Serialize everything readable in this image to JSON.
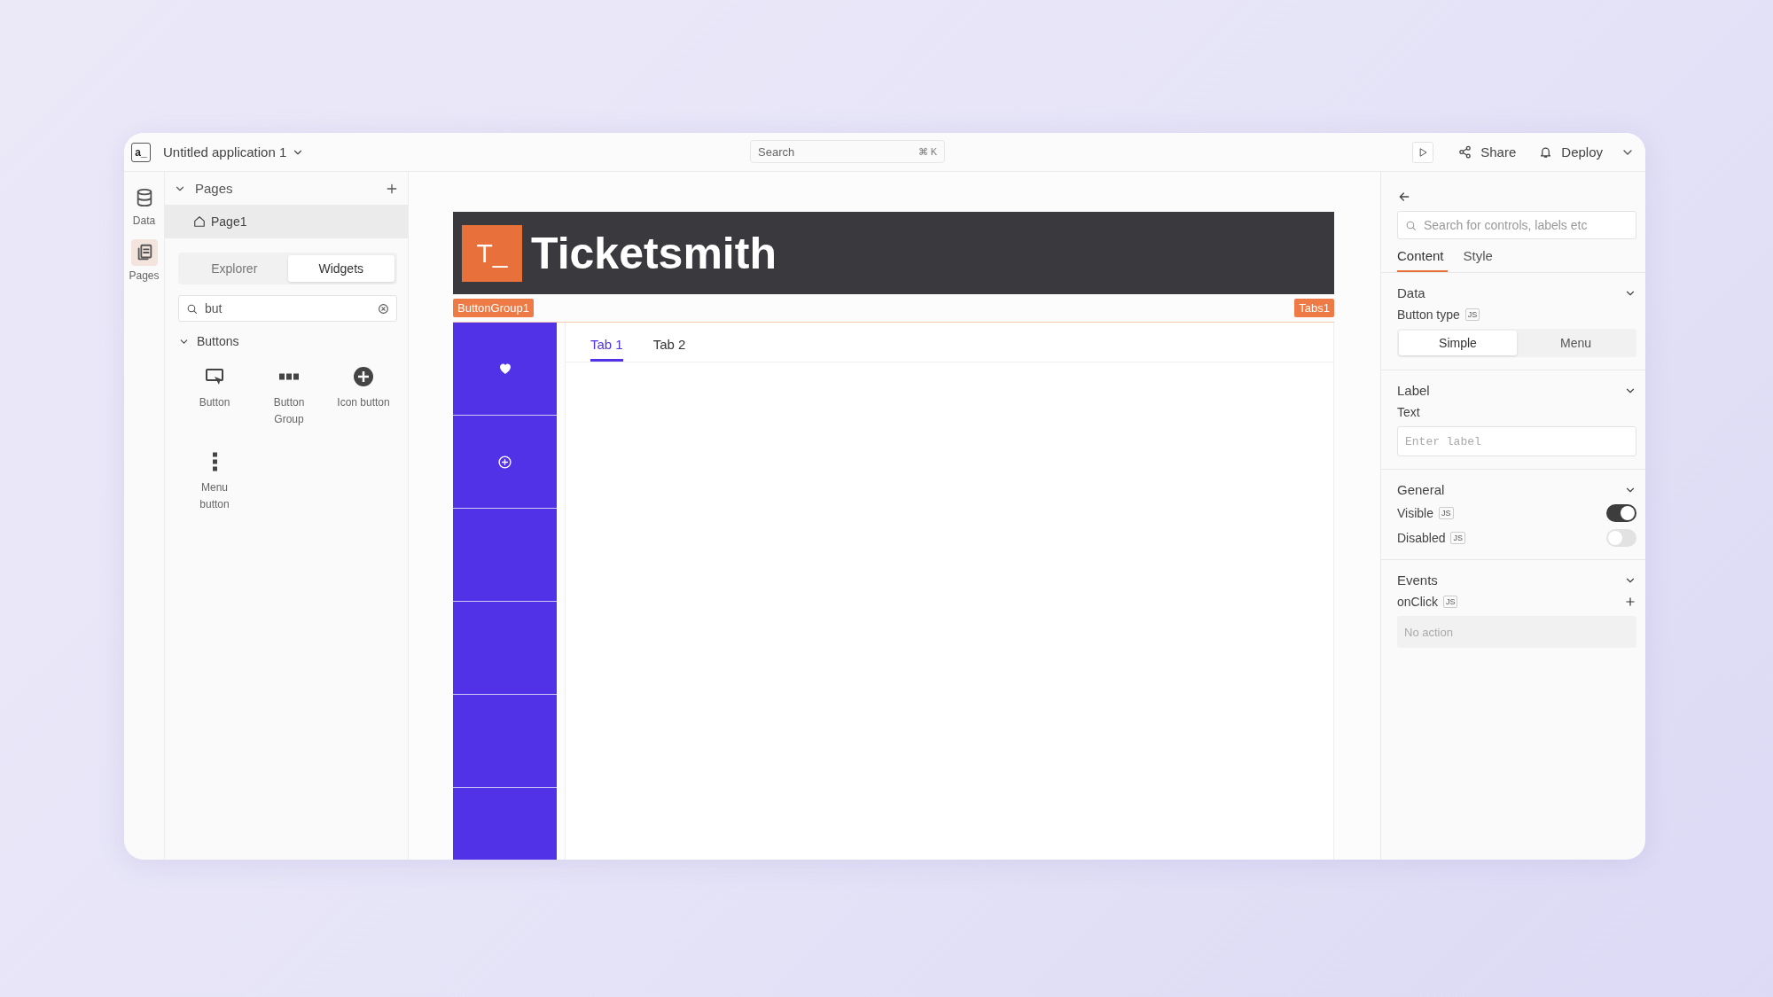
{
  "app": {
    "logo": "a_",
    "title": "Untitled application 1"
  },
  "search": {
    "placeholder": "Search",
    "shortcut": "⌘ K"
  },
  "actions": [
    {
      "kind": "play"
    },
    {
      "kind": "share",
      "label": "Share"
    },
    {
      "kind": "deploy",
      "label": "Deploy"
    }
  ],
  "rail": [
    {
      "kind": "data",
      "label": "Data",
      "selected": false
    },
    {
      "kind": "pages",
      "label": "Pages",
      "selected": true
    }
  ],
  "pages": {
    "title": "Pages",
    "expanded": true,
    "items": [
      {
        "label": "Page1",
        "selected": true
      }
    ]
  },
  "panel_tabs": [
    {
      "label": "Explorer",
      "selected": false
    },
    {
      "label": "Widgets",
      "selected": true
    }
  ],
  "widget_search": {
    "value": "but"
  },
  "widget_group": {
    "title": "Buttons",
    "expanded": true,
    "items": [
      {
        "kind": "button",
        "label": "Button"
      },
      {
        "kind": "group",
        "label": "Button Group"
      },
      {
        "kind": "icon",
        "label": "Icon button"
      },
      {
        "kind": "menu",
        "label": "Menu button"
      }
    ]
  },
  "canvas": {
    "header": {
      "logo": "T_",
      "title": "Ticketsmith"
    },
    "button_group": {
      "tag": "ButtonGroup1",
      "buttons": [
        {
          "kind": "heart"
        },
        {
          "kind": "plus"
        },
        {
          "kind": "blank"
        },
        {
          "kind": "blank"
        },
        {
          "kind": "blank"
        },
        {
          "kind": "blank"
        }
      ]
    },
    "tabs_widget": {
      "tag": "Tabs1",
      "tabs": [
        {
          "label": "Tab 1",
          "selected": true
        },
        {
          "label": "Tab 2",
          "selected": false
        }
      ]
    }
  },
  "inspector": {
    "search_placeholder": "Search for controls, labels etc",
    "tabs": [
      {
        "label": "Content",
        "selected": true
      },
      {
        "label": "Style",
        "selected": false
      }
    ],
    "sections": [
      {
        "title": "Data",
        "expanded": true,
        "fields": [
          {
            "kind": "segmented",
            "label": "Button type",
            "badge": "JS",
            "options": [
              {
                "label": "Simple",
                "selected": true
              },
              {
                "label": "Menu",
                "selected": false
              }
            ]
          }
        ]
      },
      {
        "title": "Label",
        "expanded": true,
        "fields": [
          {
            "kind": "text",
            "label": "Text",
            "placeholder": "Enter label"
          }
        ]
      },
      {
        "title": "General",
        "expanded": true,
        "fields": [
          {
            "kind": "toggle",
            "label": "Visible",
            "badge": "JS",
            "on": true
          },
          {
            "kind": "toggle",
            "label": "Disabled",
            "badge": "JS",
            "on": false
          }
        ]
      },
      {
        "title": "Events",
        "expanded": true,
        "fields": [
          {
            "kind": "action",
            "label": "onClick",
            "badge": "JS",
            "value": "No action"
          }
        ]
      }
    ]
  }
}
